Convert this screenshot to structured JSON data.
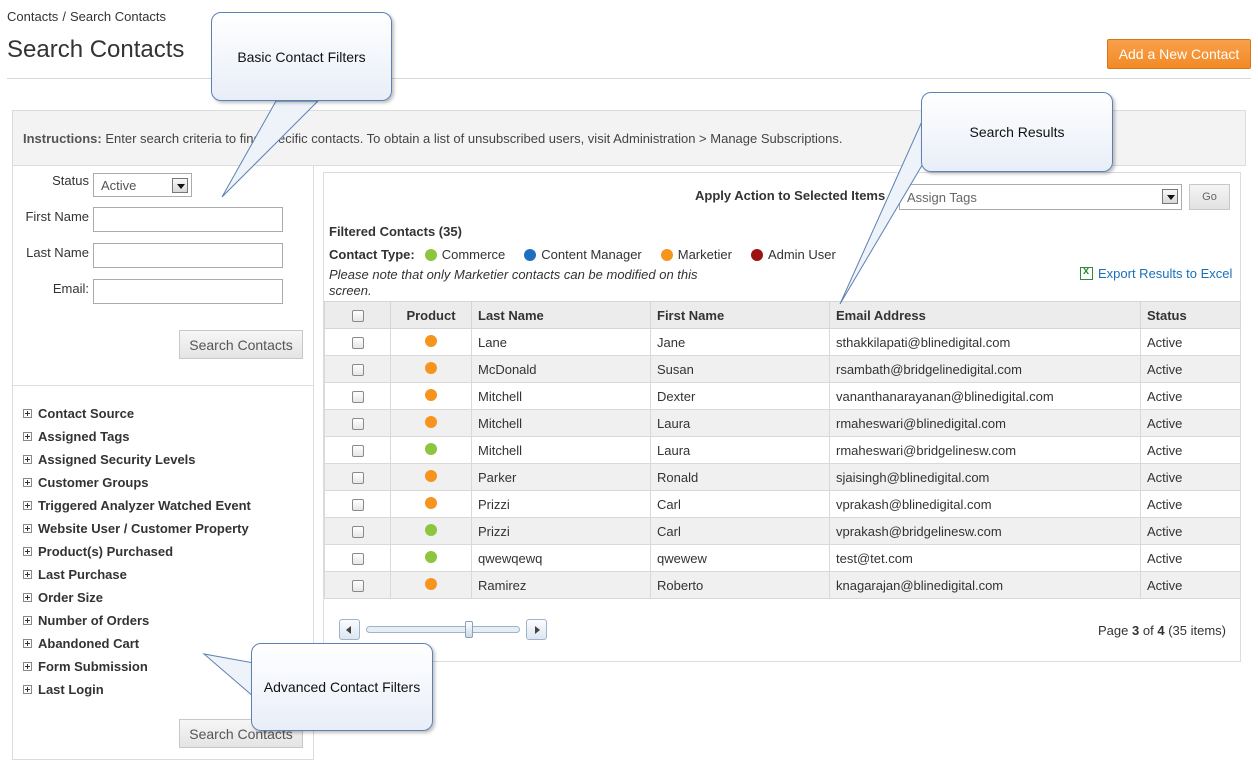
{
  "breadcrumb": {
    "root": "Contacts",
    "separator": "/",
    "current": "Search Contacts"
  },
  "page": {
    "title": "Search Contacts",
    "add_button": "Add a New Contact"
  },
  "instructions": {
    "label": "Instructions:",
    "text": "Enter search criteria to find specific contacts. To obtain a list of unsubscribed users, visit Administration > Manage Subscriptions."
  },
  "basic_filters": {
    "status_label": "Status",
    "status_value": "Active",
    "first_name_label": "First Name",
    "last_name_label": "Last Name",
    "email_label": "Email:",
    "search_button": "Search Contacts"
  },
  "advanced_filters": {
    "items": [
      "Contact Source",
      "Assigned Tags",
      "Assigned Security Levels",
      "Customer Groups",
      "Triggered Analyzer Watched Event",
      "Website User / Customer Property",
      "Product(s) Purchased",
      "Last Purchase",
      "Order Size",
      "Number of Orders",
      "Abandoned Cart",
      "Form Submission",
      "Last Login"
    ],
    "search_button": "Search Contacts"
  },
  "results": {
    "apply_label": "Apply Action to Selected Items",
    "action_value": "Assign Tags",
    "go_button": "Go",
    "filtered_title": "Filtered Contacts (35)",
    "contact_type_label": "Contact Type:",
    "legend": [
      {
        "name": "Commerce",
        "color": "#8cc63e"
      },
      {
        "name": "Content Manager",
        "color": "#1f6fbf"
      },
      {
        "name": "Marketier",
        "color": "#f7941d"
      },
      {
        "name": "Admin User",
        "color": "#9b1212"
      }
    ],
    "note": "Please note that only Marketier contacts can be modified on this screen.",
    "export_link": "Export Results to Excel",
    "columns": [
      "Product",
      "Last Name",
      "First Name",
      "Email Address",
      "Status"
    ],
    "rows": [
      {
        "type": "Marketier",
        "color": "#f7941d",
        "last": "Lane",
        "first": "Jane",
        "email": "sthakkilapati@blinedigital.com",
        "status": "Active"
      },
      {
        "type": "Marketier",
        "color": "#f7941d",
        "last": "McDonald",
        "first": "Susan",
        "email": "rsambath@bridgelinedigital.com",
        "status": "Active"
      },
      {
        "type": "Marketier",
        "color": "#f7941d",
        "last": "Mitchell",
        "first": "Dexter",
        "email": "vananthanarayanan@blinedigital.com",
        "status": "Active"
      },
      {
        "type": "Marketier",
        "color": "#f7941d",
        "last": "Mitchell",
        "first": "Laura",
        "email": "rmaheswari@blinedigital.com",
        "status": "Active"
      },
      {
        "type": "Commerce",
        "color": "#8cc63e",
        "last": "Mitchell",
        "first": "Laura",
        "email": "rmaheswari@bridgelinesw.com",
        "status": "Active"
      },
      {
        "type": "Marketier",
        "color": "#f7941d",
        "last": "Parker",
        "first": "Ronald",
        "email": "sjaisingh@blinedigital.com",
        "status": "Active"
      },
      {
        "type": "Marketier",
        "color": "#f7941d",
        "last": "Prizzi",
        "first": "Carl",
        "email": "vprakash@blinedigital.com",
        "status": "Active"
      },
      {
        "type": "Commerce",
        "color": "#8cc63e",
        "last": "Prizzi",
        "first": "Carl",
        "email": "vprakash@bridgelinesw.com",
        "status": "Active"
      },
      {
        "type": "Commerce",
        "color": "#8cc63e",
        "last": "qwewqewq",
        "first": "qwewew",
        "email": "test@tet.com",
        "status": "Active"
      },
      {
        "type": "Marketier",
        "color": "#f7941d",
        "last": "Ramirez",
        "first": "Roberto",
        "email": "knagarajan@blinedigital.com",
        "status": "Active"
      }
    ],
    "pager": {
      "prefix": "Page",
      "current": "3",
      "of": "of",
      "total": "4",
      "items": "(35 items)",
      "slider_fraction": 0.67
    }
  },
  "callouts": {
    "basic": "Basic Contact Filters",
    "results": "Search Results",
    "advanced": "Advanced Contact Filters"
  }
}
